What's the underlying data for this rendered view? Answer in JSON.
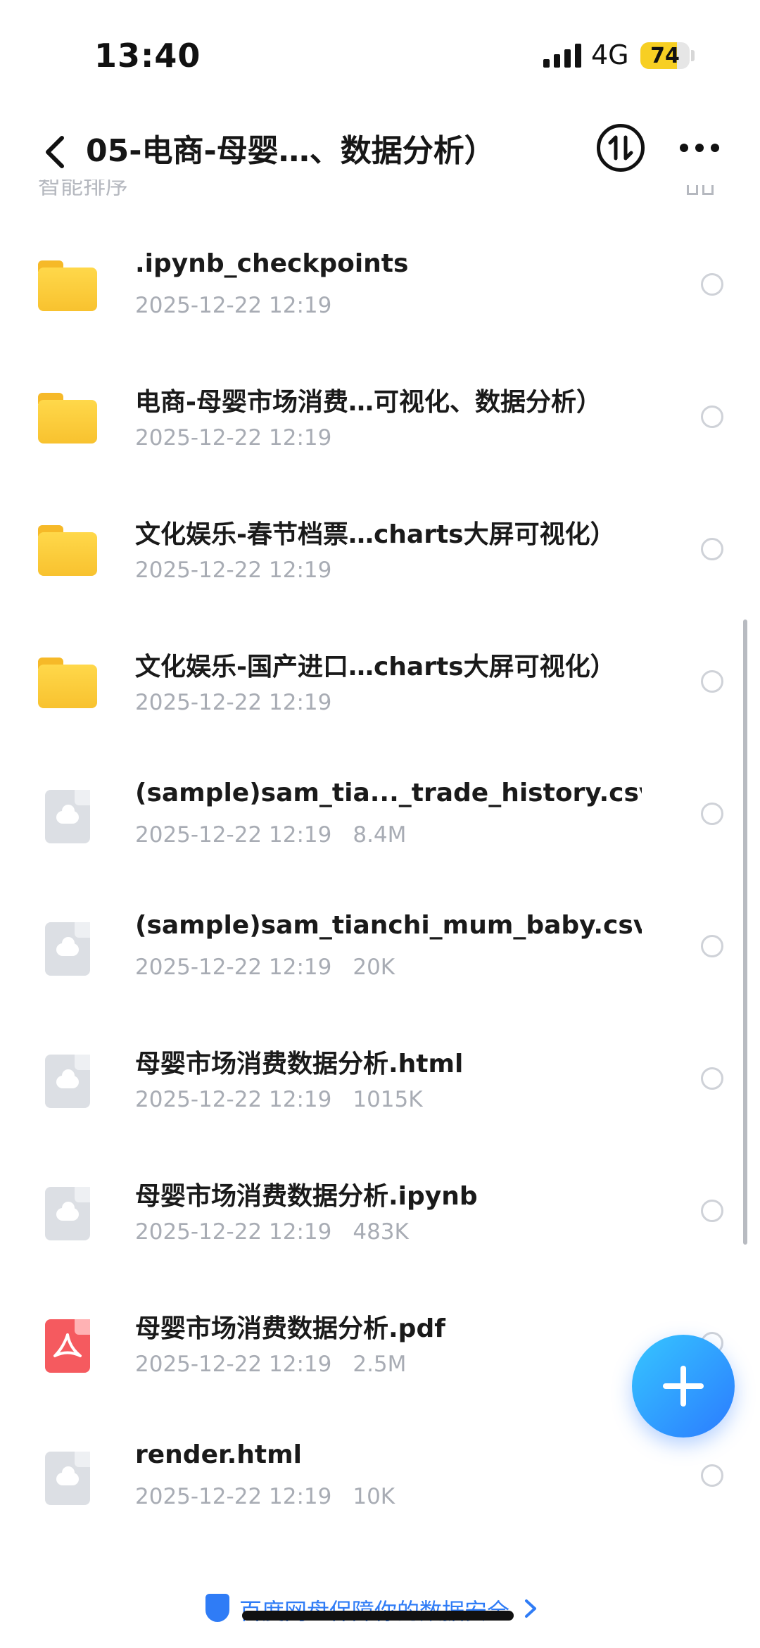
{
  "status_bar": {
    "time": "13:40",
    "network": "4G",
    "battery_level": "74",
    "battery_fraction": 0.74,
    "battery_color": "#f7cf23"
  },
  "header": {
    "back_icon": "chevron-left-icon",
    "title": "05-电商-母婴…、数据分析）",
    "transfer_icon": "upload-download-icon",
    "more_icon": "more-dots-icon"
  },
  "toolbar": {
    "sort_label": "智能排序",
    "view_toggle_icon": "grid-view-icon"
  },
  "files": [
    {
      "icon": "folder-icon",
      "name": ".ipynb_checkpoints",
      "date": "2025-12-22 12:19",
      "size": ""
    },
    {
      "icon": "folder-icon",
      "name": "电商-母婴市场消费…可视化、数据分析）",
      "date": "2025-12-22 12:19",
      "size": ""
    },
    {
      "icon": "folder-icon",
      "name": "文化娱乐-春节档票…charts大屏可视化）",
      "date": "2025-12-22 12:19",
      "size": ""
    },
    {
      "icon": "folder-icon",
      "name": "文化娱乐-国产进口…charts大屏可视化）",
      "date": "2025-12-22 12:19",
      "size": ""
    },
    {
      "icon": "cloud-file-icon",
      "name": "(sample)sam_tia..._trade_history.csv",
      "date": "2025-12-22 12:19",
      "size": "8.4M"
    },
    {
      "icon": "cloud-file-icon",
      "name": "(sample)sam_tianchi_mum_baby.csv",
      "date": "2025-12-22 12:19",
      "size": "20K"
    },
    {
      "icon": "cloud-file-icon",
      "name": "母婴市场消费数据分析.html",
      "date": "2025-12-22 12:19",
      "size": "1015K"
    },
    {
      "icon": "cloud-file-icon",
      "name": "母婴市场消费数据分析.ipynb",
      "date": "2025-12-22 12:19",
      "size": "483K"
    },
    {
      "icon": "pdf-file-icon",
      "name": "母婴市场消费数据分析.pdf",
      "date": "2025-12-22 12:19",
      "size": "2.5M"
    },
    {
      "icon": "cloud-file-icon",
      "name": "render.html",
      "date": "2025-12-22 12:19",
      "size": "10K"
    }
  ],
  "fab": {
    "icon": "plus-icon"
  },
  "footer": {
    "icon": "shield-icon",
    "text": "百度网盘保障你的数据安全",
    "chevron_icon": "chevron-right-icon",
    "link_color": "#2f7cf6"
  },
  "colors": {
    "folder": "#f8c22f",
    "pdf": "#f55a5f",
    "fab_gradient_start": "#36c6ff",
    "fab_gradient_end": "#2b7bff"
  }
}
